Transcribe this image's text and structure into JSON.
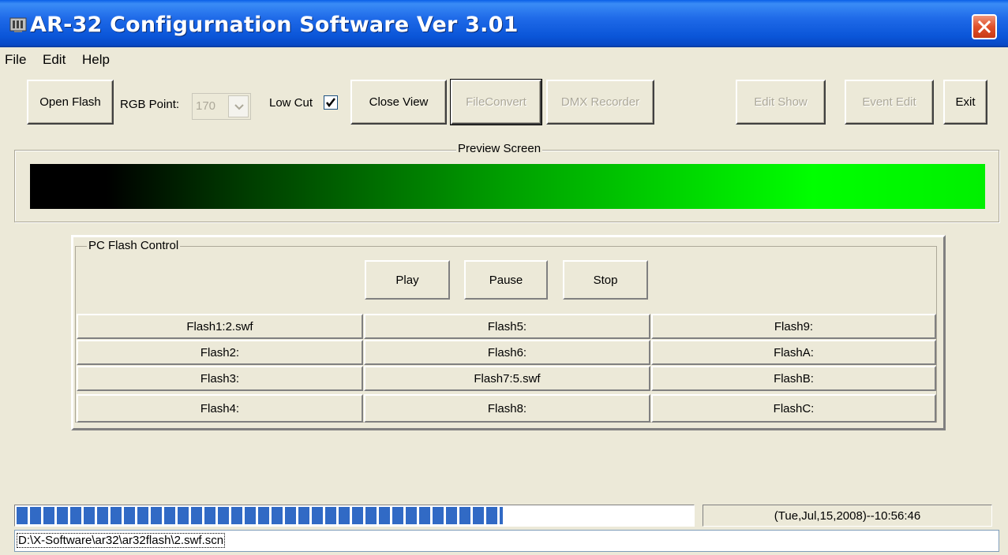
{
  "window": {
    "title": "AR-32 Configurnation Software Ver 3.01",
    "close_icon": "close-icon"
  },
  "menu": {
    "file_label": "File",
    "edit_label": "Edit",
    "help_label": "Help"
  },
  "toolbar": {
    "open_flash": "Open Flash",
    "rgb_point_label": "RGB Point:",
    "rgb_point_value": "170",
    "low_cut_label": "Low Cut",
    "low_cut_checked": true,
    "close_view": "Close View",
    "file_convert": "FileConvert",
    "dmx_recorder": "DMX Recorder",
    "edit_show": "Edit Show",
    "event_edit": "Event Edit",
    "exit": "Exit"
  },
  "preview": {
    "title": "Preview Screen"
  },
  "flash_control": {
    "title": "PC Flash Control",
    "play": "Play",
    "pause": "Pause",
    "stop": "Stop",
    "slots": [
      [
        "Flash1:2.swf",
        "Flash5:",
        "Flash9:"
      ],
      [
        "Flash2:",
        "Flash6:",
        "FlashA:"
      ],
      [
        "Flash3:",
        "Flash7:5.swf",
        "FlashB:"
      ],
      [
        "Flash4:",
        "Flash8:",
        "FlashC:"
      ]
    ]
  },
  "status": {
    "progress_fraction": 0.72,
    "datetime": "(Tue,Jul,15,2008)--10:56:46",
    "path": "D:\\X-Software\\ar32\\ar32flash\\2.swf.scn"
  }
}
